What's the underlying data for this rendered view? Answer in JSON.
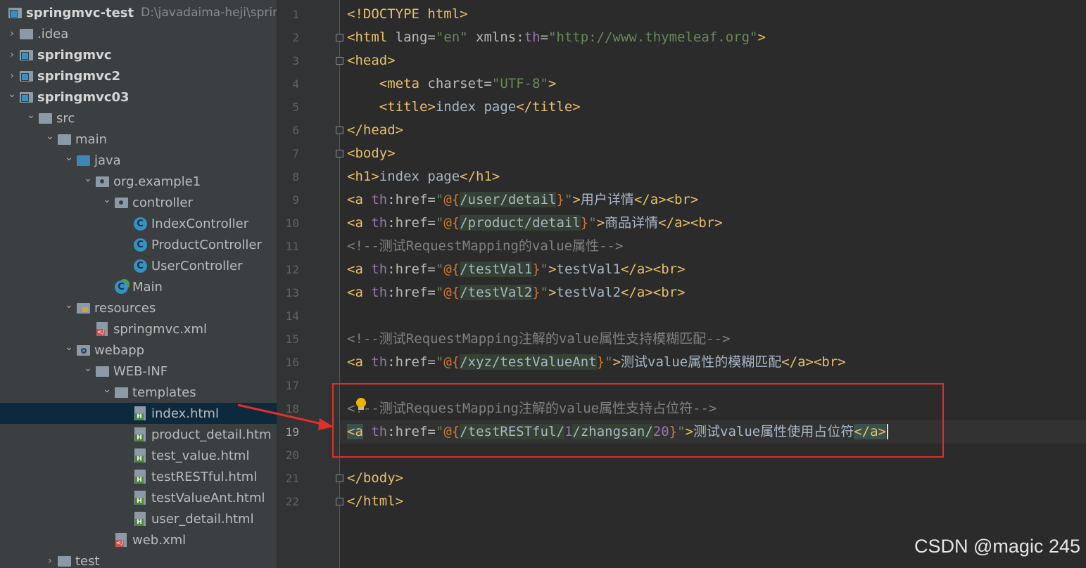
{
  "project": {
    "name": "springmvc-test",
    "path": "D:\\javadaima-heji\\spring"
  },
  "tree": [
    {
      "label": ".idea",
      "depth": 0,
      "arrow": "›",
      "icon": "folder-icon"
    },
    {
      "label": "springmvc",
      "depth": 0,
      "arrow": "›",
      "icon": "module-folder-icon",
      "bold": true
    },
    {
      "label": "springmvc2",
      "depth": 0,
      "arrow": "›",
      "icon": "module-folder-icon",
      "bold": true
    },
    {
      "label": "springmvc03",
      "depth": 0,
      "arrow": "⌄",
      "icon": "module-folder-icon",
      "bold": true
    },
    {
      "label": "src",
      "depth": 1,
      "arrow": "⌄",
      "icon": "folder-icon"
    },
    {
      "label": "main",
      "depth": 2,
      "arrow": "⌄",
      "icon": "folder-icon"
    },
    {
      "label": "java",
      "depth": 3,
      "arrow": "⌄",
      "icon": "source-folder-icon"
    },
    {
      "label": "org.example1",
      "depth": 4,
      "arrow": "⌄",
      "icon": "package-icon"
    },
    {
      "label": "controller",
      "depth": 5,
      "arrow": "⌄",
      "icon": "package-icon"
    },
    {
      "label": "IndexController",
      "depth": 6,
      "arrow": "",
      "icon": "class-icon"
    },
    {
      "label": "ProductController",
      "depth": 6,
      "arrow": "",
      "icon": "class-icon"
    },
    {
      "label": "UserController",
      "depth": 6,
      "arrow": "",
      "icon": "class-icon"
    },
    {
      "label": "Main",
      "depth": 5,
      "arrow": "",
      "icon": "main-class-icon"
    },
    {
      "label": "resources",
      "depth": 3,
      "arrow": "⌄",
      "icon": "resources-folder-icon"
    },
    {
      "label": "springmvc.xml",
      "depth": 4,
      "arrow": "",
      "icon": "xml-file-icon"
    },
    {
      "label": "webapp",
      "depth": 3,
      "arrow": "⌄",
      "icon": "web-folder-icon"
    },
    {
      "label": "WEB-INF",
      "depth": 4,
      "arrow": "⌄",
      "icon": "folder-icon"
    },
    {
      "label": "templates",
      "depth": 5,
      "arrow": "⌄",
      "icon": "folder-icon"
    },
    {
      "label": "index.html",
      "depth": 6,
      "arrow": "",
      "icon": "html-file-icon",
      "selected": true
    },
    {
      "label": "product_detail.htm",
      "depth": 6,
      "arrow": "",
      "icon": "html-file-icon"
    },
    {
      "label": "test_value.html",
      "depth": 6,
      "arrow": "",
      "icon": "html-file-icon"
    },
    {
      "label": "testRESTful.html",
      "depth": 6,
      "arrow": "",
      "icon": "html-file-icon"
    },
    {
      "label": "testValueAnt.html",
      "depth": 6,
      "arrow": "",
      "icon": "html-file-icon"
    },
    {
      "label": "user_detail.html",
      "depth": 6,
      "arrow": "",
      "icon": "html-file-icon"
    },
    {
      "label": "web.xml",
      "depth": 5,
      "arrow": "",
      "icon": "xml-file-icon"
    },
    {
      "label": "test",
      "depth": 2,
      "arrow": "›",
      "icon": "folder-icon"
    }
  ],
  "editor": {
    "current_line": 19,
    "lines": [
      [
        [
          "tag",
          "<!DOCTYPE html>"
        ]
      ],
      [
        [
          "tag",
          "<html "
        ],
        [
          "attr",
          "lang="
        ],
        [
          "str",
          "\"en\""
        ],
        [
          "attr",
          " xmlns:"
        ],
        [
          "ns",
          "th"
        ],
        [
          "attr",
          "="
        ],
        [
          "str",
          "\"http://www.thymeleaf.org\""
        ],
        [
          "tag",
          ">"
        ]
      ],
      [
        [
          "tag",
          "<head>"
        ]
      ],
      [
        [
          "txt",
          "    "
        ],
        [
          "tag",
          "<meta "
        ],
        [
          "attr",
          "charset="
        ],
        [
          "str",
          "\"UTF-8\""
        ],
        [
          "tag",
          ">"
        ]
      ],
      [
        [
          "txt",
          "    "
        ],
        [
          "tag",
          "<title>"
        ],
        [
          "txt",
          "index page"
        ],
        [
          "tag",
          "</title>"
        ]
      ],
      [
        [
          "tag",
          "</head>"
        ]
      ],
      [
        [
          "tag",
          "<body>"
        ]
      ],
      [
        [
          "tag",
          "<h1>"
        ],
        [
          "txt",
          "index page"
        ],
        [
          "tag",
          "</h1>"
        ]
      ],
      [
        [
          "tag",
          "<a "
        ],
        [
          "ns",
          "th"
        ],
        [
          "attr",
          ":href="
        ],
        [
          "str",
          "\""
        ],
        [
          "expr",
          "@{"
        ],
        [
          "hl",
          "/user/detail"
        ],
        [
          "expr",
          "}"
        ],
        [
          "str",
          "\""
        ],
        [
          "tag",
          ">"
        ],
        [
          "txt",
          "用户详情"
        ],
        [
          "tag",
          "</a><br>"
        ]
      ],
      [
        [
          "tag",
          "<a "
        ],
        [
          "ns",
          "th"
        ],
        [
          "attr",
          ":href="
        ],
        [
          "str",
          "\""
        ],
        [
          "expr",
          "@{"
        ],
        [
          "hl",
          "/product/detail"
        ],
        [
          "expr",
          "}"
        ],
        [
          "str",
          "\""
        ],
        [
          "tag",
          ">"
        ],
        [
          "txt",
          "商品详情"
        ],
        [
          "tag",
          "</a><br>"
        ]
      ],
      [
        [
          "cmt",
          "<!--测试RequestMapping的value属性-->"
        ]
      ],
      [
        [
          "tag",
          "<a "
        ],
        [
          "ns",
          "th"
        ],
        [
          "attr",
          ":href="
        ],
        [
          "str",
          "\""
        ],
        [
          "expr",
          "@{"
        ],
        [
          "hl",
          "/testVal1"
        ],
        [
          "expr",
          "}"
        ],
        [
          "str",
          "\""
        ],
        [
          "tag",
          ">"
        ],
        [
          "txt",
          "testVal1"
        ],
        [
          "tag",
          "</a><br>"
        ]
      ],
      [
        [
          "tag",
          "<a "
        ],
        [
          "ns",
          "th"
        ],
        [
          "attr",
          ":href="
        ],
        [
          "str",
          "\""
        ],
        [
          "expr",
          "@{"
        ],
        [
          "hl",
          "/testVal2"
        ],
        [
          "expr",
          "}"
        ],
        [
          "str",
          "\""
        ],
        [
          "tag",
          ">"
        ],
        [
          "txt",
          "testVal2"
        ],
        [
          "tag",
          "</a><br>"
        ]
      ],
      [],
      [
        [
          "cmt",
          "<!--测试RequestMapping注解的value属性支持模糊匹配-->"
        ]
      ],
      [
        [
          "tag",
          "<a "
        ],
        [
          "ns",
          "th"
        ],
        [
          "attr",
          ":href="
        ],
        [
          "str",
          "\""
        ],
        [
          "expr",
          "@{"
        ],
        [
          "hl",
          "/xyz/testValueAnt"
        ],
        [
          "expr",
          "}"
        ],
        [
          "str",
          "\""
        ],
        [
          "tag",
          ">"
        ],
        [
          "txt",
          "测试value属性的模糊匹配"
        ],
        [
          "tag",
          "</a><br>"
        ]
      ],
      [],
      [
        [
          "cmt",
          "<!--测试RequestMapping注解的value属性支持占位符-->"
        ]
      ],
      [
        [
          "hlmatch",
          "<a"
        ],
        [
          "tag",
          " "
        ],
        [
          "ns",
          "th"
        ],
        [
          "attr",
          ":href="
        ],
        [
          "str",
          "\""
        ],
        [
          "expr",
          "@{"
        ],
        [
          "hl",
          "/testRESTful/"
        ],
        [
          "ns",
          "1"
        ],
        [
          "hl",
          "/zhangsan/"
        ],
        [
          "ns",
          "20"
        ],
        [
          "expr",
          "}"
        ],
        [
          "str",
          "\""
        ],
        [
          "tag",
          ">"
        ],
        [
          "txt",
          "测试value属性使用占位符"
        ],
        [
          "hlmatch",
          "</a>"
        ]
      ],
      [],
      [
        [
          "tag",
          "</body>"
        ]
      ],
      [
        [
          "tag",
          "</html>"
        ]
      ]
    ]
  },
  "watermark": "CSDN @magic 245"
}
